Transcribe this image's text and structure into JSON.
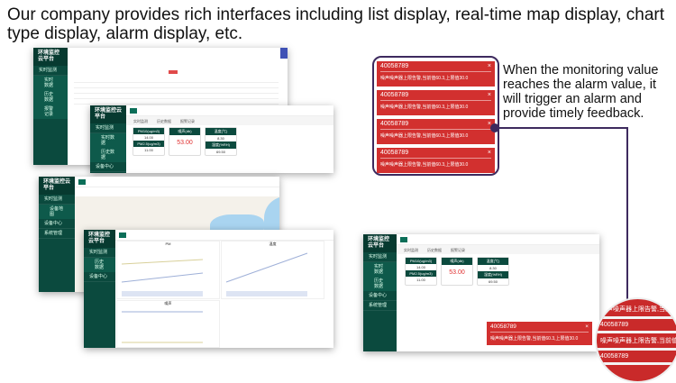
{
  "headline": "Our company provides rich interfaces including list display, real-time map display, chart type display, alarm display, etc.",
  "description": "When the monitoring value reaches the alarm value, it will trigger an alarm and provide timely feedback.",
  "app": {
    "brand": "环境监控云平台",
    "menu": [
      "实时监测",
      "设备中心",
      "系统管理"
    ],
    "submenu": [
      "实时数据",
      "历史数据",
      "报警记录",
      "设备地图"
    ],
    "tabs": [
      "实时监测",
      "历史数据",
      "报警记录"
    ]
  },
  "cards": [
    {
      "label": "PM10(ug/m3)",
      "value": "14.00"
    },
    {
      "label": "噪声(db)",
      "value": "53.00",
      "unit": "噪声"
    },
    {
      "label": "温度(℃)",
      "value": "8.30"
    },
    {
      "label": "PM2.5(ug/m3)",
      "value": "11.00"
    },
    {
      "label": "湿度(%RH)",
      "value": "69.50"
    }
  ],
  "charts": [
    "PM",
    "温度",
    "噪声"
  ],
  "alarms": [
    {
      "id": "40058789",
      "message": "噪声噪声器上限告警,当前值60.3,上限值30.0"
    },
    {
      "id": "40058789",
      "message": "噪声噪声器上限告警,当前值60.3,上限值30.0"
    },
    {
      "id": "40058789",
      "message": "噪声噪声器上限告警,当前值60.3,上限值30.0"
    },
    {
      "id": "40058789",
      "message": "噪声噪声器上限告警,当前值60.3,上限值30.0"
    }
  ],
  "popup": {
    "id": "40058789",
    "message": "噪声噪声器上限告警,当前值60.3,上限值30.0"
  },
  "close": "×",
  "colors": {
    "sidebar": "#0b4a3e",
    "alarm": "#d2302f",
    "accent": "#3d2a5e"
  }
}
